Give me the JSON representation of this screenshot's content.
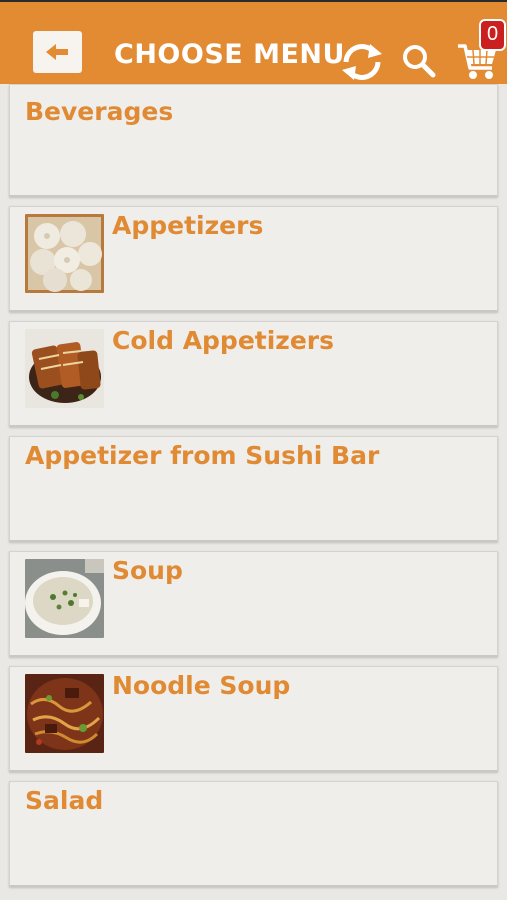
{
  "header": {
    "title": "CHOOSE MENU",
    "cart_count": "0",
    "accent_color": "#e28b33",
    "badge_color": "#cc1f1f",
    "back_icon": "back-arrow-icon",
    "refresh_icon": "refresh-icon",
    "search_icon": "search-icon",
    "cart_icon": "cart-icon"
  },
  "menu": {
    "items": [
      {
        "label": "Beverages",
        "has_image": false
      },
      {
        "label": "Appetizers",
        "has_image": true,
        "image": "dumplings"
      },
      {
        "label": "Cold Appetizers",
        "has_image": true,
        "image": "glazed-fish"
      },
      {
        "label": "Appetizer from Sushi Bar",
        "has_image": false
      },
      {
        "label": "Soup",
        "has_image": true,
        "image": "soup-bowl"
      },
      {
        "label": "Noodle Soup",
        "has_image": true,
        "image": "noodle-soup"
      },
      {
        "label": "Salad",
        "has_image": false
      }
    ]
  }
}
